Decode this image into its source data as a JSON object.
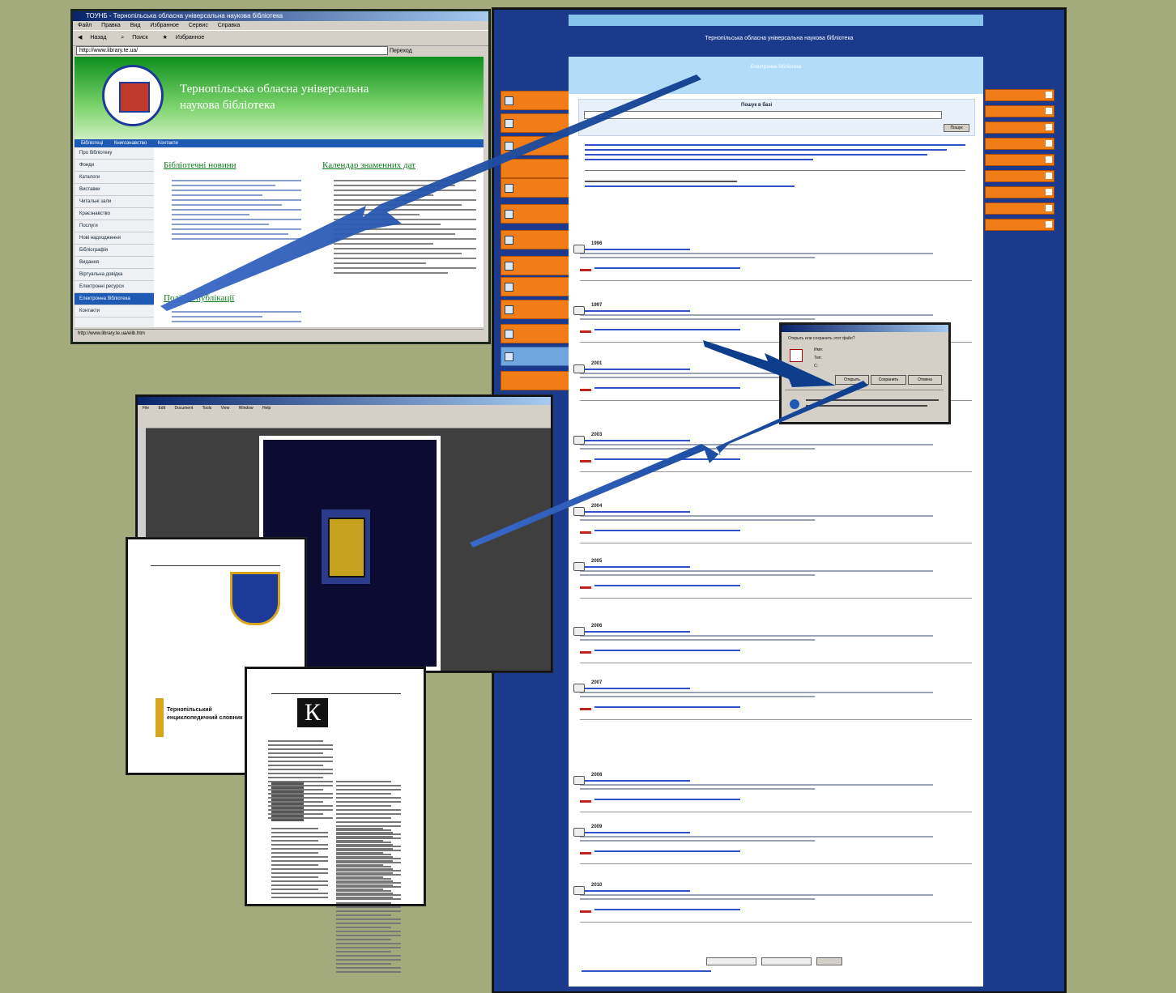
{
  "browser": {
    "title": "ТОУНБ - Тернопільська обласна універсальна наукова бібліотека",
    "menu": [
      "Файл",
      "Правка",
      "Вид",
      "Избранное",
      "Сервис",
      "Справка"
    ],
    "toolbar": [
      "Назад",
      "Поиск",
      "Избранное"
    ],
    "address": "http://www.library.te.ua/",
    "go_label": "Переход",
    "hero_title": "Тернопільська обласна універсальна наукова бібліотека",
    "nav": [
      "Бібліотеці",
      "Книгознавство",
      "Контакти"
    ],
    "left_nav": [
      "Про бібліотеку",
      "Фонди",
      "Каталоги",
      "Виставки",
      "Читальні зали",
      "Краєзнавство",
      "Послуги",
      "Нові надходження",
      "Бібліографія",
      "Видання",
      "Віртуальна довідка",
      "Електронні ресурси",
      "Електронна бібліотека",
      "Контакти"
    ],
    "left_nav_selected": "Електронна бібліотека",
    "col1_title": "Бібліотечні новини",
    "col2_title": "Події та публікації",
    "col3_title": "Календар знаменних дат",
    "status": "http://www.library.te.ua/elib.htm"
  },
  "catalog": {
    "header": "Тернопільська обласна універсальна наукова бібліотека",
    "main_heading": "Електронна бібліотека",
    "search_label": "Пошук в базі",
    "search_button": "Пошук",
    "records": [
      {
        "year": "1996"
      },
      {
        "year": "1997"
      },
      {
        "year": "2001"
      },
      {
        "year": "2003"
      },
      {
        "year": "2004"
      },
      {
        "year": "2005"
      },
      {
        "year": "2006"
      },
      {
        "year": "2007"
      },
      {
        "year": "2008"
      },
      {
        "year": "2009"
      },
      {
        "year": "2010"
      }
    ]
  },
  "dialog": {
    "title": "Загрузка файла",
    "question": "Открыть или сохранить этот файл?",
    "name_label": "Имя:",
    "type_label": "Тип:",
    "from_label": "С:",
    "open_button": "Открыть",
    "save_button": "Сохранить",
    "cancel_button": "Отмена"
  },
  "reader": {
    "menu": [
      "File",
      "Edit",
      "Document",
      "Tools",
      "View",
      "Window",
      "Help"
    ]
  },
  "paper1": {
    "title": "Тернопільський енциклопедичний словник"
  },
  "paper2": {
    "drop_cap": "К"
  },
  "colors": {
    "background": "#a3ab7c",
    "catalog_blue": "#1c3a8c",
    "orange": "#f07d18",
    "arrow": "#0e3d8c"
  }
}
